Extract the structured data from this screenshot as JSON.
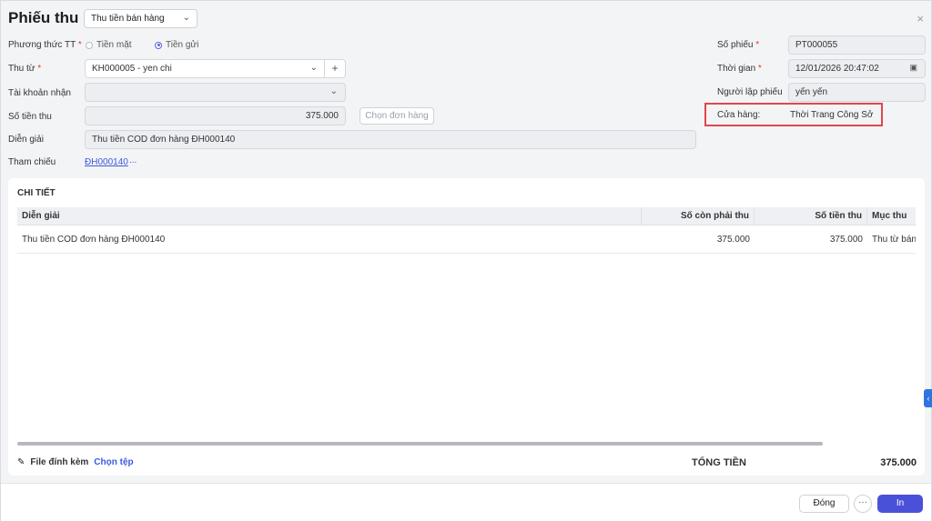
{
  "header": {
    "title": "Phiếu thu",
    "type_select": "Thu tiền bán hàng",
    "close_icon": "×"
  },
  "form_left": {
    "payment_method_label": "Phương thức TT",
    "payment_options": [
      "Tiền mặt",
      "Tiền gửi"
    ],
    "payment_selected": "Tiền gửi",
    "from_label": "Thu từ",
    "from_value": "KH000005 - yen chi",
    "account_label": "Tài khoản nhận",
    "account_value": "",
    "amount_label": "Số tiền thu",
    "amount_value": "375.000",
    "choose_order_button": "Chọn đơn hàng",
    "description_label": "Diễn giải",
    "description_value": "Thu tiền COD đơn hàng ĐH000140",
    "reference_label": "Tham chiếu",
    "reference_link": "ĐH000140",
    "reference_more": "..."
  },
  "form_right": {
    "voucher_no_label": "Số phiếu",
    "voucher_no_value": "PT000055",
    "time_label": "Thời gian",
    "time_value": "12/01/2026 20:47:02",
    "creator_label": "Người lập phiếu",
    "creator_value": "yến yến",
    "store_label": "Cửa hàng:",
    "store_value": "Thời Trang Công Sở"
  },
  "detail": {
    "title": "CHI TIẾT",
    "columns": [
      "Diễn giải",
      "Số còn phải thu",
      "Số tiền thu",
      "Mục thu"
    ],
    "rows": [
      {
        "description": "Thu tiền COD đơn hàng ĐH000140",
        "remaining": "375.000",
        "amount": "375.000",
        "category": "Thu từ bán h"
      }
    ],
    "attachment_label": "File đính kèm",
    "choose_file": "Chọn tệp",
    "total_label": "TỔNG TIỀN",
    "total_value": "375.000"
  },
  "footer": {
    "close_button": "Đóng",
    "more_button": "···",
    "print_button": "In"
  },
  "colors": {
    "accent": "#4a51d8",
    "link": "#3b5bdb",
    "highlight_border": "#e0474c",
    "required": "#e53935"
  }
}
